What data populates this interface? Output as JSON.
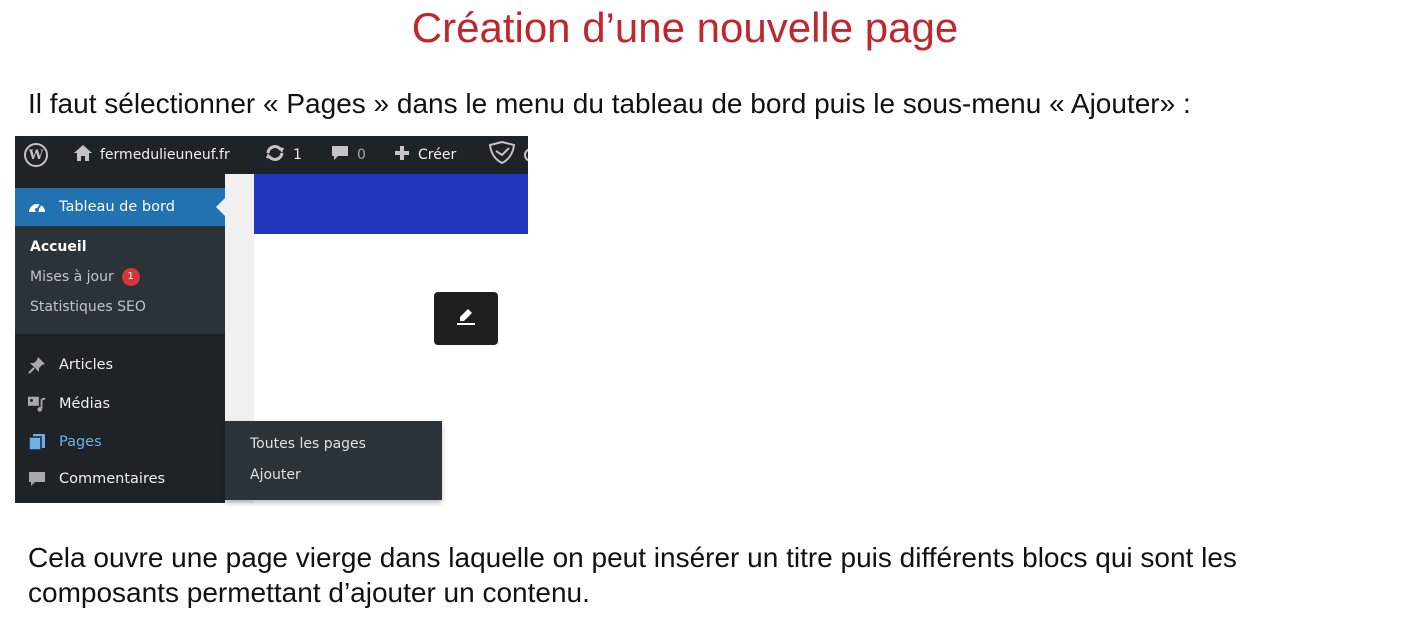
{
  "doc": {
    "title": "Création d’une nouvelle page",
    "intro": "Il faut sélectionner « Pages » dans le menu du tableau de bord puis le sous-menu « Ajouter»  :",
    "outro": "Cela ouvre une page vierge dans laquelle on peut insérer un titre puis différents blocs qui sont les composants permettant d’ajouter un contenu."
  },
  "adminbar": {
    "site_name": "fermedulieuneuf.fr",
    "updates_count": "1",
    "comments_count": "0",
    "new_label": "Créer",
    "icons": [
      "wordpress-icon",
      "home-icon",
      "updates-icon",
      "comment-icon",
      "plus-icon",
      "shield-icon"
    ]
  },
  "sidebar": {
    "active": {
      "label": "Tableau de bord",
      "icon": "dashboard-icon"
    },
    "submenu": [
      {
        "label": "Accueil"
      },
      {
        "label": "Mises à jour",
        "badge": "1"
      },
      {
        "label": "Statistiques SEO"
      }
    ],
    "items": [
      {
        "label": "Articles",
        "icon": "pin-icon"
      },
      {
        "label": "Médias",
        "icon": "media-icon"
      },
      {
        "label": "Pages",
        "icon": "pages-icon"
      },
      {
        "label": "Commentaires",
        "icon": "comment-icon"
      }
    ]
  },
  "flyout": {
    "items": [
      {
        "label": "Toutes les pages"
      },
      {
        "label": "Ajouter"
      }
    ]
  },
  "colors": {
    "title_red": "#c0272d",
    "admin_dark": "#1d2327",
    "wp_blue": "#2271b1",
    "header_blue": "#2135bf",
    "badge_red": "#d63638"
  }
}
